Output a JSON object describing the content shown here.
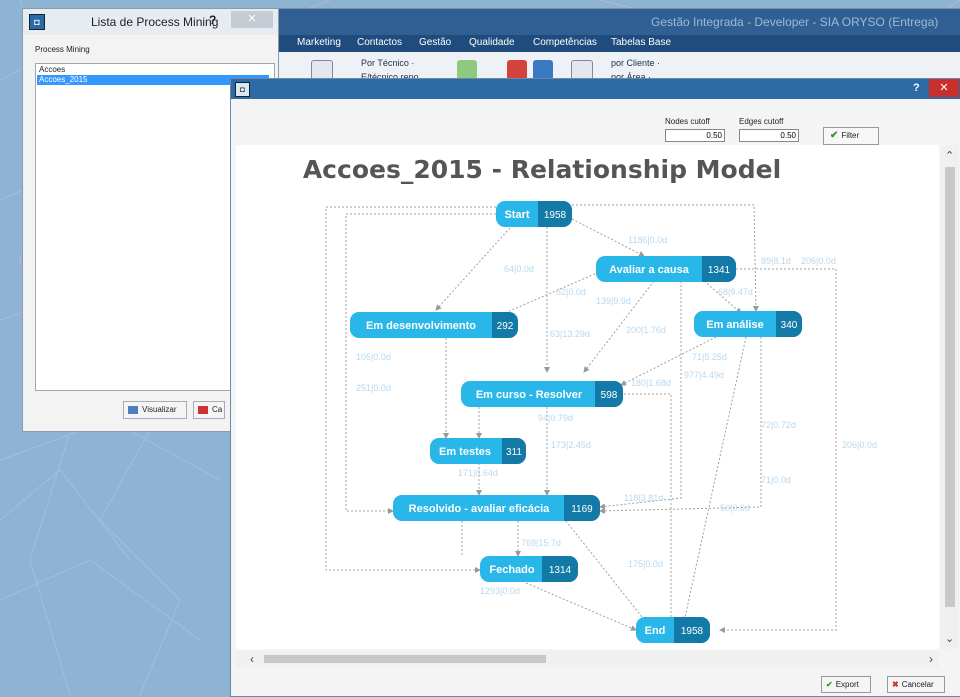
{
  "background_app": {
    "title": "Gestão Integrada - Developer - SIA ORYSO (Entrega)",
    "menu": [
      "Marketing",
      "Contactos",
      "Gestão",
      "Qualidade",
      "Competências",
      "Tabelas Base"
    ],
    "ribbon": {
      "por_tecnico": "Por Técnico ·",
      "por_tecnico_sub": "E/técnico repo",
      "por_cliente": "por Cliente ·",
      "por_area": "por Área ·"
    }
  },
  "list_window": {
    "title": "Lista de Process Mining",
    "help": "?",
    "close": "✕",
    "label": "Process Mining",
    "items": [
      {
        "text": "Accoes",
        "selected": false
      },
      {
        "text": "Accoes_2015",
        "selected": true
      }
    ],
    "visualizar": "Visualizar",
    "cancelar": "Ca"
  },
  "diagram_window": {
    "help": "?",
    "close": "✕",
    "nodes_cutoff_label": "Nodes cutoff",
    "nodes_cutoff_value": "0.50",
    "edges_cutoff_label": "Edges cutoff",
    "edges_cutoff_value": "0.50",
    "filter": "Filter",
    "export": "Export",
    "cancelar": "Cancelar"
  },
  "diagram": {
    "title": "Accoes_2015 - Relationship Model",
    "colors": {
      "node": "#29b6e8",
      "count": "#137aa8",
      "edge": "#a0a0a0",
      "edge_label": "#b8d8ef"
    },
    "nodes": [
      {
        "id": "start",
        "label": "Start",
        "count": "1958"
      },
      {
        "id": "avaliar",
        "label": "Avaliar a causa",
        "count": "1341"
      },
      {
        "id": "desenv",
        "label": "Em desenvolvimento",
        "count": "292"
      },
      {
        "id": "analise",
        "label": "Em análise",
        "count": "340"
      },
      {
        "id": "curso",
        "label": "Em curso - Resolver",
        "count": "598"
      },
      {
        "id": "testes",
        "label": "Em testes",
        "count": "311"
      },
      {
        "id": "resolvido",
        "label": "Resolvido - avaliar eficácia",
        "count": "1169"
      },
      {
        "id": "fechado",
        "label": "Fechado",
        "count": "1314"
      },
      {
        "id": "end",
        "label": "End",
        "count": "1958"
      }
    ],
    "edge_labels": [
      "1186|0.0d",
      "64|0.0d",
      "89|8.1d",
      "206|0.0d",
      "62|0.0d",
      "68|9.47d",
      "139|9.9d",
      "200|1.76d",
      "63|13.29d",
      "105|0.0d",
      "71|5.25d",
      "977|4.49d",
      "251|0.0d",
      "180|1.68d",
      "94|0.79d",
      "72|0.72d",
      "206|0.0d",
      "173|2.45d",
      "171|0.64d",
      "71|0.0d",
      "118|3.81d",
      "50|0.0d",
      "769|15.7d",
      "175|0.0d",
      "1293|0.0d"
    ]
  }
}
